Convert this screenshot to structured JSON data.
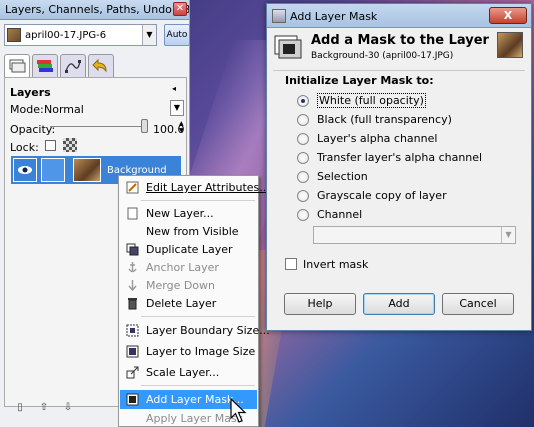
{
  "dock": {
    "title": "Layers, Channels, Paths, Undo - Br...",
    "image_selector": "april00-17.JPG-6",
    "auto_button": "Auto",
    "panel_title": "Layers",
    "mode_label": "Mode:",
    "mode_value": "Normal",
    "opacity_label": "Opacity:",
    "opacity_value": "100.0",
    "lock_label": "Lock:",
    "layer_name": "Background"
  },
  "context_menu": {
    "items": [
      {
        "label": "Edit Layer Attributes...",
        "state": "enabled"
      },
      {
        "label": "New Layer...",
        "state": "enabled"
      },
      {
        "label": "New from Visible",
        "state": "enabled"
      },
      {
        "label": "Duplicate Layer",
        "state": "enabled"
      },
      {
        "label": "Anchor Layer",
        "state": "disabled"
      },
      {
        "label": "Merge Down",
        "state": "disabled"
      },
      {
        "label": "Delete Layer",
        "state": "enabled"
      },
      {
        "label": "Layer Boundary Size...",
        "state": "enabled"
      },
      {
        "label": "Layer to Image Size",
        "state": "enabled"
      },
      {
        "label": "Scale Layer...",
        "state": "enabled"
      },
      {
        "label": "Add Layer Mask...",
        "state": "highlighted"
      },
      {
        "label": "Apply Layer Mask",
        "state": "disabled"
      }
    ]
  },
  "dialog": {
    "window_title": "Add Layer Mask",
    "close_label": "X",
    "heading": "Add a Mask to the Layer",
    "subheading": "Background-30 (april00-17.JPG)",
    "section_label": "Initialize Layer Mask to:",
    "options": [
      "White (full opacity)",
      "Black (full transparency)",
      "Layer's alpha channel",
      "Transfer layer's alpha channel",
      "Selection",
      "Grayscale copy of layer",
      "Channel"
    ],
    "selected_option": "White (full opacity)",
    "invert_label": "Invert mask",
    "invert_checked": false,
    "help_button": "Help",
    "add_button": "Add",
    "cancel_button": "Cancel"
  }
}
